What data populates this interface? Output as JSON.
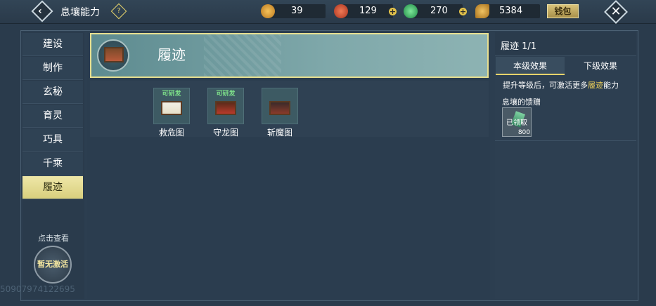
{
  "header": {
    "title": "息壤能力",
    "back_icon": "back-arrow-icon",
    "help_icon": "question-icon",
    "wallet_label": "钱包",
    "close_icon": "close-icon",
    "resources": [
      {
        "name": "gold-pouch-icon",
        "value": "39",
        "color": "#e6a23c"
      },
      {
        "name": "red-orb-icon",
        "value": "129",
        "color": "#d05a3a"
      },
      {
        "name": "jade-ring-icon",
        "value": "270",
        "color": "#3fbf6a"
      },
      {
        "name": "feather-icon",
        "value": "5384",
        "color": "#d4a23a"
      }
    ]
  },
  "sidebar": {
    "items": [
      {
        "label": "建设"
      },
      {
        "label": "制作"
      },
      {
        "label": "玄秘"
      },
      {
        "label": "育灵"
      },
      {
        "label": "巧具"
      },
      {
        "label": "千乘"
      },
      {
        "label": "履迹",
        "active": true
      }
    ],
    "check_label": "点击查看",
    "emblem_label": "暂无激活"
  },
  "uid": "50907974122695",
  "main": {
    "banner_title": "履迹",
    "cards": [
      {
        "flag": "可研发",
        "label": "救危图"
      },
      {
        "flag": "可研发",
        "label": "守龙图"
      },
      {
        "flag": "",
        "label": "斩魔图"
      }
    ]
  },
  "panel": {
    "title": "履迹 1/1",
    "tabs": [
      "本级效果",
      "下级效果"
    ],
    "desc_pre": "提升等级后，可激活更多",
    "desc_highlight": "履迹",
    "desc_post": "能力",
    "gift_label": "息壤的馈赠",
    "gift_status": "已领取",
    "gift_count": "800"
  }
}
